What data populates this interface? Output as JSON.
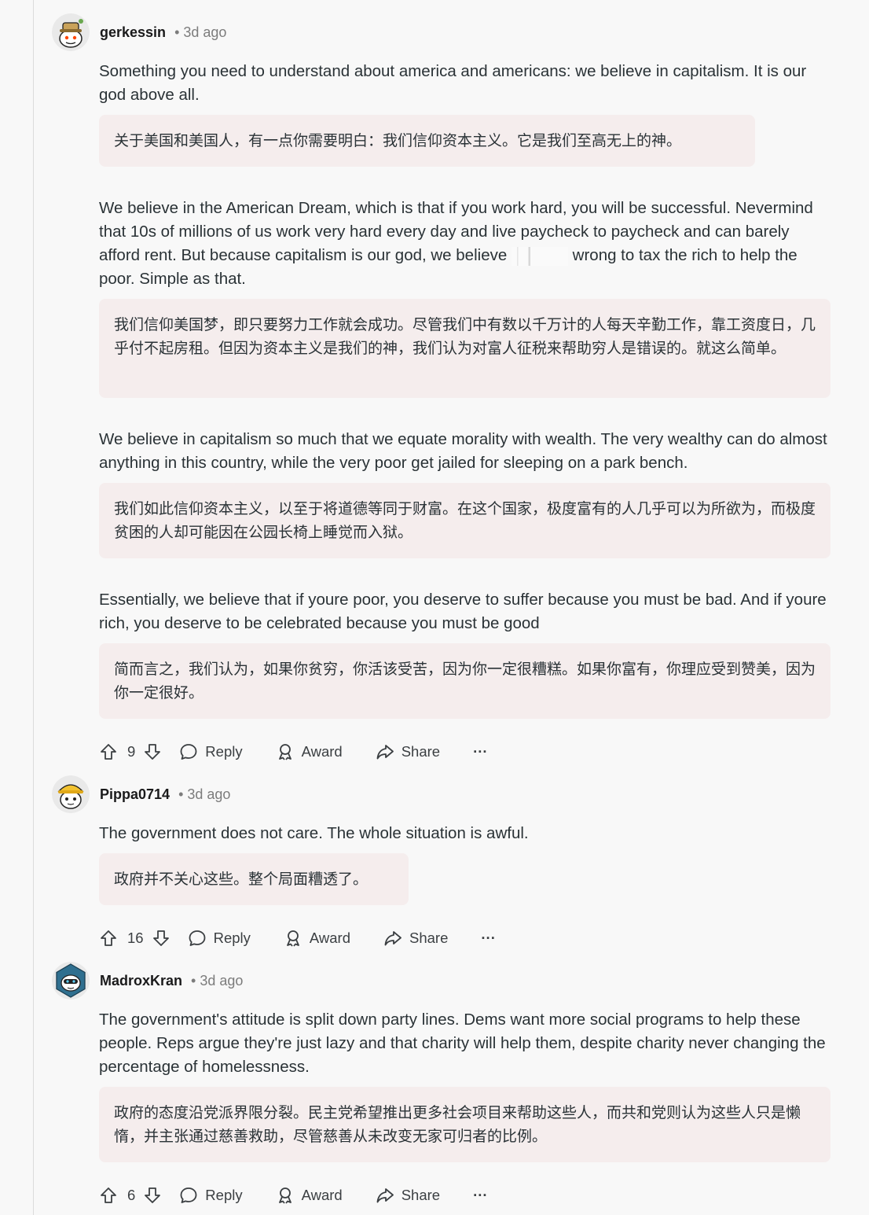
{
  "colors": {
    "background": "#f8f8f8",
    "quote_bg": "#f5eded",
    "text": "#2a3236",
    "meta": "#7c7c7c"
  },
  "comments": [
    {
      "username": "gerkessin",
      "separator": "•",
      "time": "3d ago",
      "avatar_icon": "snoo-avatar-hat",
      "paragraphs": [
        {
          "en": "Something you need to understand about america and americans: we believe in capitalism. It is our god above all.",
          "cn": "关于美国和美国人，有一点你需要明白：我们信仰资本主义。它是我们至高无上的神。"
        },
        {
          "en_a": "We believe in the American Dream, which is that if you work hard, you will be successful. Nevermind that 10s of millions of us work very hard every day and live paycheck to paycheck and can barely afford rent. But because capitalism is our god, we believe",
          "en_b": "wrong to tax the rich to help the poor. Simple as that.",
          "cn": "我们信仰美国梦，即只要努力工作就会成功。尽管我们中有数以千万计的人每天辛勤工作，靠工资度日，几乎付不起房租。但因为资本主义是我们的神，我们认为对富人征税来帮助穷人是错误的。就这么简单。"
        },
        {
          "en": "We believe in capitalism so much that we equate morality with wealth. The very wealthy can do almost anything in this country, while the very poor get jailed for sleeping on a park bench.",
          "cn": "我们如此信仰资本主义，以至于将道德等同于财富。在这个国家，极度富有的人几乎可以为所欲为，而极度贫困的人却可能因在公园长椅上睡觉而入狱。"
        },
        {
          "en": "Essentially, we believe that if youre poor, you deserve to suffer because you must be bad. And if youre rich, you deserve to be celebrated because you must be good",
          "cn": "简而言之，我们认为，如果你贫穷，你活该受苦，因为你一定很糟糕。如果你富有，你理应受到赞美，因为你一定很好。"
        }
      ],
      "votes": "9",
      "reply": "Reply",
      "award": "Award",
      "share": "Share",
      "more": "···"
    },
    {
      "username": "Pippa0714",
      "separator": "•",
      "time": "3d ago",
      "avatar_icon": "snoo-avatar-yellow-hat",
      "paragraphs": [
        {
          "en": "The government does not care. The whole situation is awful.",
          "cn": "政府并不关心这些。整个局面糟透了。"
        }
      ],
      "votes": "16",
      "reply": "Reply",
      "award": "Award",
      "share": "Share",
      "more": "···"
    },
    {
      "username": "MadroxKran",
      "separator": "•",
      "time": "3d ago",
      "avatar_icon": "snoo-avatar-robot-hex",
      "paragraphs": [
        {
          "en": "The government's attitude is split down party lines. Dems want more social programs to help these people. Reps argue they're just lazy and that charity will help them, despite charity never changing the percentage of homelessness.",
          "cn": "政府的态度沿党派界限分裂。民主党希望推出更多社会项目来帮助这些人，而共和党则认为这些人只是懒惰，并主张通过慈善救助，尽管慈善从未改变无家可归者的比例。"
        }
      ],
      "votes": "6",
      "reply": "Reply",
      "award": "Award",
      "share": "Share",
      "more": "···"
    }
  ]
}
